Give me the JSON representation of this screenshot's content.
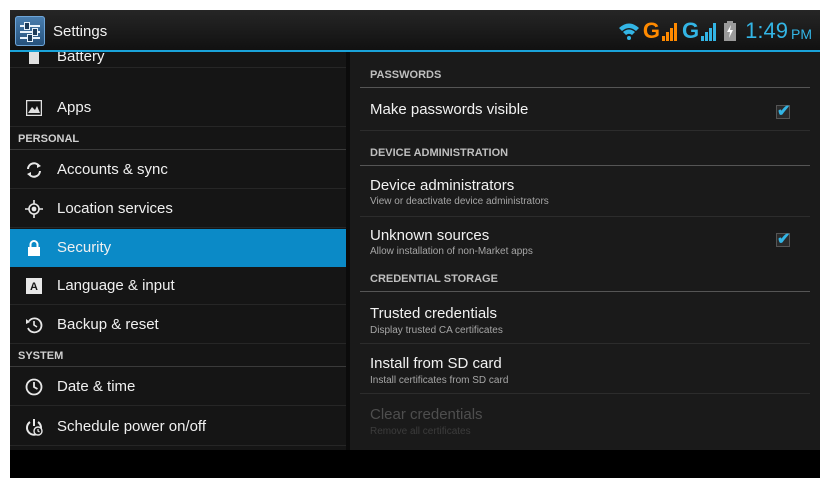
{
  "header": {
    "title": "Settings",
    "app_icon": "settings-sliders-icon",
    "accent_color": "#1aa3d9"
  },
  "status_bar": {
    "icons": [
      "wifi-icon",
      "network-g-icon",
      "signal-strength-icon",
      "network-g-icon",
      "signal-strength-icon",
      "battery-charging-icon"
    ],
    "network_1": "G",
    "network_2": "G",
    "network_1_color": "#ff8a00",
    "network_2_color": "#33b5e5",
    "clock": "1:49",
    "ampm": "PM"
  },
  "sidebar": {
    "items": [
      {
        "label": "Battery",
        "icon": "battery-icon"
      },
      {
        "label": "Apps",
        "icon": "apps-icon"
      },
      {
        "label": "Accounts & sync",
        "icon": "sync-icon"
      },
      {
        "label": "Location services",
        "icon": "location-icon"
      },
      {
        "label": "Security",
        "icon": "lock-icon",
        "selected": true
      },
      {
        "label": "Language & input",
        "icon": "keyboard-icon"
      },
      {
        "label": "Backup & reset",
        "icon": "backup-icon"
      },
      {
        "label": "Date & time",
        "icon": "clock-icon"
      },
      {
        "label": "Schedule power on/off",
        "icon": "power-schedule-icon"
      }
    ],
    "sections": {
      "personal": "PERSONAL",
      "system": "SYSTEM"
    },
    "selected_color": "#0b8ac7"
  },
  "security": {
    "categories": {
      "passwords": "PASSWORDS",
      "device_admin": "DEVICE ADMINISTRATION",
      "credential_storage": "CREDENTIAL STORAGE"
    },
    "prefs": {
      "make_passwords_visible": {
        "title": "Make passwords visible",
        "checked": true
      },
      "device_administrators": {
        "title": "Device administrators",
        "summary": "View or deactivate device administrators"
      },
      "unknown_sources": {
        "title": "Unknown sources",
        "summary": "Allow installation of non-Market apps",
        "checked": true
      },
      "trusted_credentials": {
        "title": "Trusted credentials",
        "summary": "Display trusted CA certificates"
      },
      "install_from_sd": {
        "title": "Install from SD card",
        "summary": "Install certificates from SD card"
      },
      "clear_credentials": {
        "title": "Clear credentials",
        "summary": "Remove all certificates",
        "enabled": false
      }
    }
  }
}
